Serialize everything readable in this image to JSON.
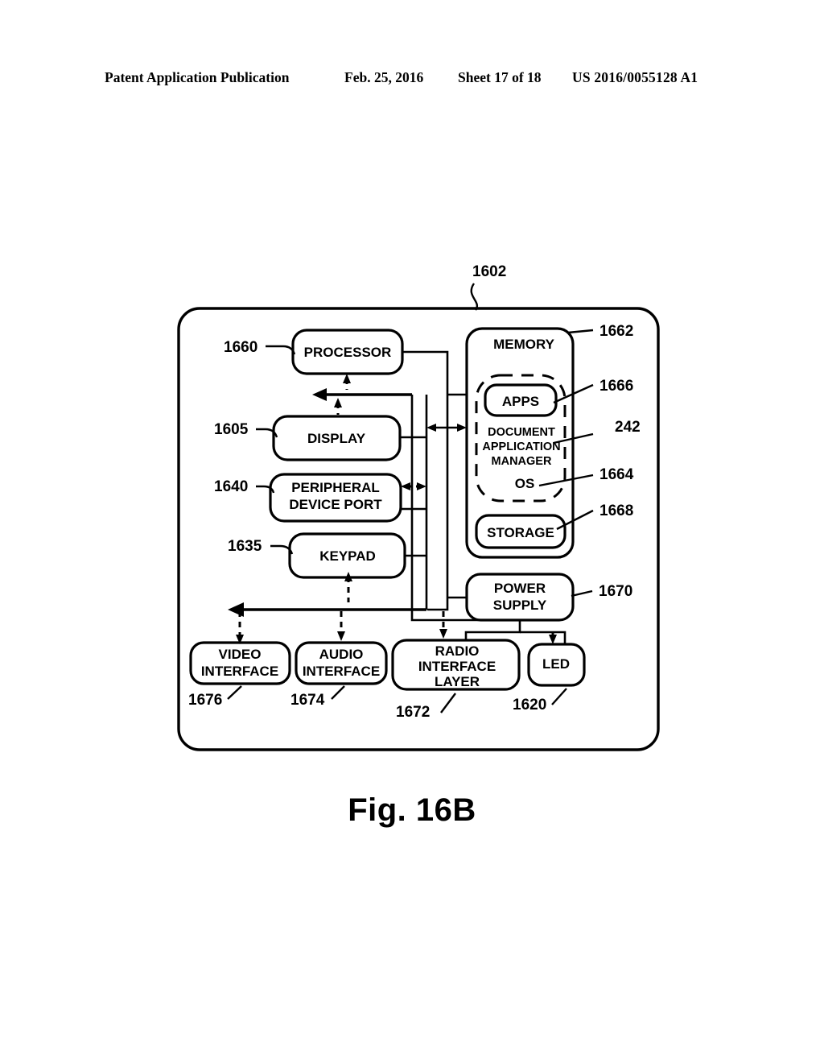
{
  "header": {
    "publication": "Patent Application Publication",
    "date": "Feb. 25, 2016",
    "sheet": "Sheet 17 of 18",
    "patent_number": "US 2016/0055128 A1"
  },
  "figure": {
    "caption": "Fig. 16B",
    "device_ref": "1602"
  },
  "blocks": {
    "processor": {
      "label": "PROCESSOR",
      "ref": "1660"
    },
    "display": {
      "label": "DISPLAY",
      "ref": "1605"
    },
    "peripheral_port": {
      "label_line1": "PERIPHERAL",
      "label_line2": "DEVICE PORT",
      "ref": "1640"
    },
    "keypad": {
      "label": "KEYPAD",
      "ref": "1635"
    },
    "memory": {
      "label": "MEMORY",
      "ref": "1662"
    },
    "apps": {
      "label": "APPS",
      "ref": "1666"
    },
    "document_app_mgr": {
      "label_line1": "DOCUMENT",
      "label_line2": "APPLICATION",
      "label_line3": "MANAGER",
      "ref": "242"
    },
    "os": {
      "label": "OS",
      "ref": "1664"
    },
    "storage": {
      "label": "STORAGE",
      "ref": "1668"
    },
    "power_supply": {
      "label_line1": "POWER",
      "label_line2": "SUPPLY",
      "ref": "1670"
    },
    "video_interface": {
      "label_line1": "VIDEO",
      "label_line2": "INTERFACE",
      "ref": "1676"
    },
    "audio_interface": {
      "label_line1": "AUDIO",
      "label_line2": "INTERFACE",
      "ref": "1674"
    },
    "radio_interface": {
      "label_line1": "RADIO",
      "label_line2": "INTERFACE",
      "label_line3": "LAYER",
      "ref": "1672"
    },
    "led": {
      "label": "LED",
      "ref": "1620"
    }
  },
  "colors": {
    "ink": "#000000",
    "paper": "#ffffff"
  }
}
